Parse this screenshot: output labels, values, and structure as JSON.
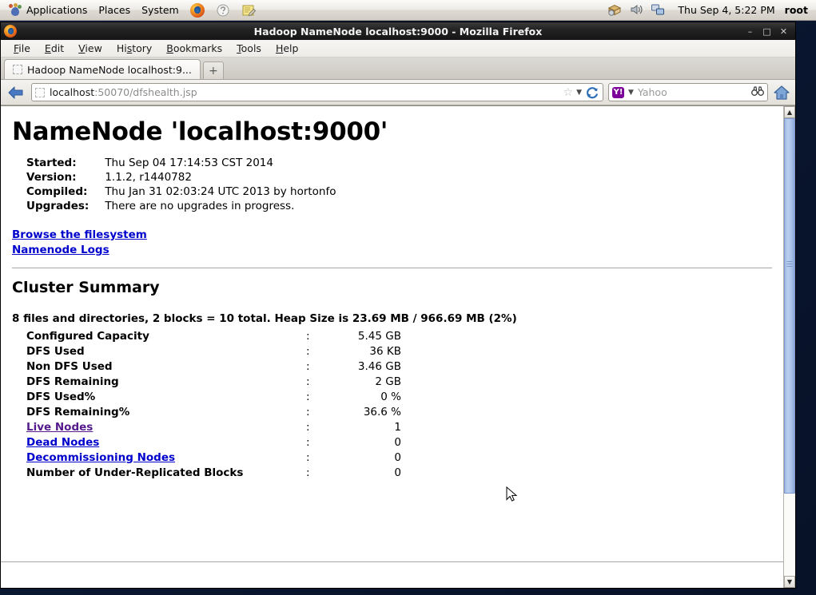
{
  "panel": {
    "logo_icon": "gnome-foot-icon",
    "menus": [
      "Applications",
      "Places",
      "System"
    ],
    "launchers": [
      {
        "icon": "firefox-icon",
        "name": "launcher-firefox"
      },
      {
        "icon": "help-icon",
        "name": "launcher-help"
      },
      {
        "icon": "text-editor-icon",
        "name": "launcher-text-editor"
      }
    ],
    "tray": [
      {
        "icon": "package-update-icon",
        "name": "tray-update"
      },
      {
        "icon": "volume-icon",
        "name": "tray-volume"
      },
      {
        "icon": "network-icon",
        "name": "tray-network"
      }
    ],
    "clock": "Thu Sep  4, 5:22 PM",
    "user": "root"
  },
  "window": {
    "title": "Hadoop NameNode localhost:9000 - Mozilla Firefox",
    "icon": "firefox-icon",
    "buttons": {
      "minimize": "–",
      "maximize": "□",
      "close": "✕"
    }
  },
  "menubar": [
    {
      "pre": "",
      "accel": "F",
      "post": "ile"
    },
    {
      "pre": "",
      "accel": "E",
      "post": "dit"
    },
    {
      "pre": "",
      "accel": "V",
      "post": "iew"
    },
    {
      "pre": "Hi",
      "accel": "s",
      "post": "tory"
    },
    {
      "pre": "",
      "accel": "B",
      "post": "ookmarks"
    },
    {
      "pre": "",
      "accel": "T",
      "post": "ools"
    },
    {
      "pre": "",
      "accel": "H",
      "post": "elp"
    }
  ],
  "tabbar": {
    "tab_title": "Hadoop NameNode localhost:9...",
    "new_tab_label": "+"
  },
  "navbar": {
    "back_icon": "back-arrow-icon",
    "url_host": "localhost",
    "url_rest": ":50070/dfshealth.jsp",
    "star_icon": "star-icon",
    "chevron_icon": "chevron-down-icon",
    "reload_icon": "reload-icon",
    "search_engine_badge": "Y!",
    "search_placeholder": "Yahoo",
    "search_icon": "binoculars-icon",
    "home_icon": "home-icon"
  },
  "page": {
    "heading": "NameNode 'localhost:9000'",
    "startup": [
      {
        "key": "Started:",
        "value": "Thu Sep 04 17:14:53 CST 2014"
      },
      {
        "key": "Version:",
        "value": "1.1.2, r1440782"
      },
      {
        "key": "Compiled:",
        "value": "Thu Jan 31 02:03:24 UTC 2013 by hortonfo"
      },
      {
        "key": "Upgrades:",
        "value": "There are no upgrades in progress."
      }
    ],
    "links": [
      {
        "label": "Browse the filesystem",
        "state": "blue"
      },
      {
        "label": "Namenode Logs",
        "state": "blue"
      }
    ],
    "cluster_summary_heading": "Cluster Summary",
    "heap_line": "8 files and directories, 2 blocks = 10 total. Heap Size is 23.69 MB / 966.69 MB (2%)",
    "colon": ":",
    "stats": [
      {
        "label": "Configured Capacity",
        "value": "5.45 GB",
        "link": false
      },
      {
        "label": "DFS Used",
        "value": "36 KB",
        "link": false
      },
      {
        "label": "Non DFS Used",
        "value": "3.46 GB",
        "link": false
      },
      {
        "label": "DFS Remaining",
        "value": "2 GB",
        "link": false
      },
      {
        "label": "DFS Used%",
        "value": "0 %",
        "link": false
      },
      {
        "label": "DFS Remaining%",
        "value": "36.6 %",
        "link": false
      },
      {
        "label": "Live Nodes",
        "value": "1",
        "link": true,
        "state": "visited"
      },
      {
        "label": "Dead Nodes",
        "value": "0",
        "link": true,
        "state": "blue"
      },
      {
        "label": "Decommissioning Nodes",
        "value": "0",
        "link": true,
        "state": "blue"
      },
      {
        "label": "Number of Under-Replicated Blocks",
        "value": "0",
        "link": false
      }
    ]
  },
  "scrollbar": {
    "up_arrow": "▲",
    "down_arrow": "▼"
  },
  "colors": {
    "link_blue": "#0000cc",
    "link_visited": "#551a8b",
    "scrollbar_thumb": "#a8c0e8"
  }
}
